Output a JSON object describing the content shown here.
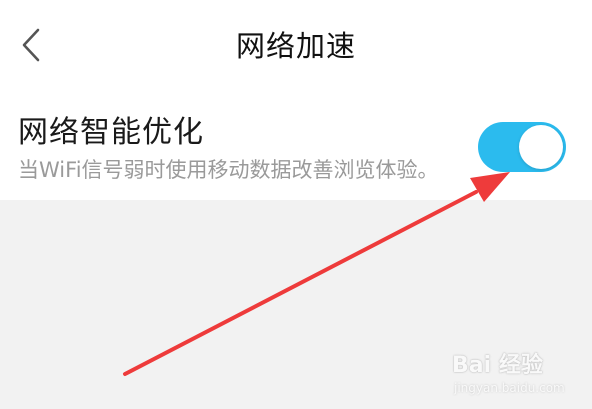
{
  "header": {
    "back_icon": "chevron-left-icon",
    "title": "网络加速"
  },
  "setting": {
    "title": "网络智能优化",
    "description": "当WiFi信号弱时使用移动数据改善浏览体验。",
    "toggle_on": true,
    "toggle_color": "#2bbbee"
  },
  "annotation": {
    "arrow_color": "#ee3b3b"
  },
  "watermark": {
    "brand": "Bai 经验",
    "url": "jingyan.baidu.com"
  },
  "colors": {
    "background": "#f2f2f2",
    "panel": "#ffffff",
    "title_text": "#111111",
    "desc_text": "#9a9a9a"
  }
}
